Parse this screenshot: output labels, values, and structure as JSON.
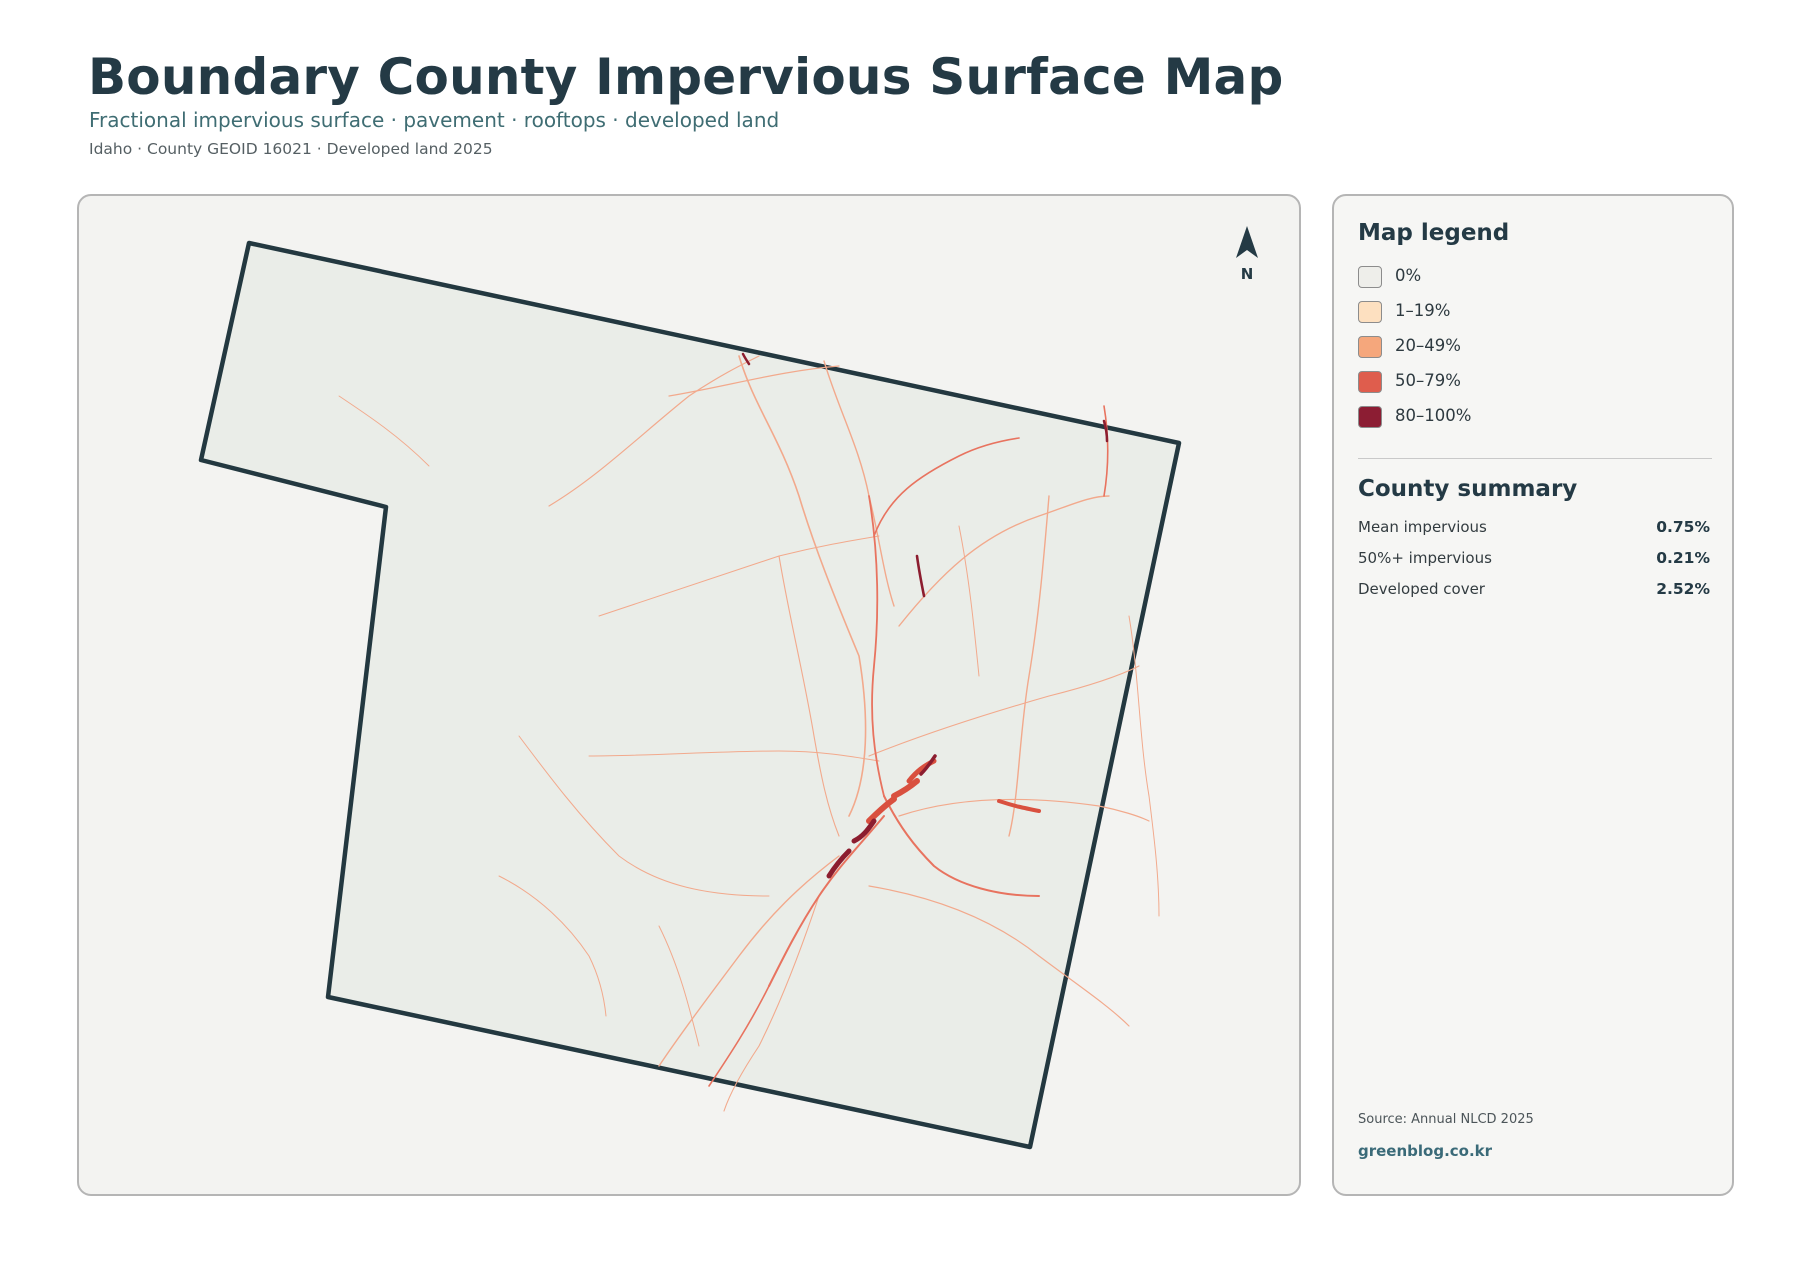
{
  "header": {
    "title": "Boundary County Impervious Surface Map",
    "subtitle": "Fractional impervious surface · pavement · rooftops · developed land",
    "meta": "Idaho · County GEOID 16021 · Developed land 2025"
  },
  "map": {
    "north_label": "N",
    "boundary_color": "#233840",
    "county_fill": "#eaede8",
    "road_colors": [
      "#f2a98c",
      "#e8735f",
      "#d9503f",
      "#8c1d2f"
    ]
  },
  "legend": {
    "title": "Map legend",
    "items": [
      {
        "label": "0%",
        "color": "#eeeeea"
      },
      {
        "label": "1–19%",
        "color": "#fde0c0"
      },
      {
        "label": "20–49%",
        "color": "#f5a77c"
      },
      {
        "label": "50–79%",
        "color": "#df5d4d"
      },
      {
        "label": "80–100%",
        "color": "#8c1d33"
      }
    ]
  },
  "summary": {
    "title": "County summary",
    "stats": [
      {
        "label": "Mean impervious",
        "value": "0.75%"
      },
      {
        "label": "50%+ impervious",
        "value": "0.21%"
      },
      {
        "label": "Developed cover",
        "value": "2.52%"
      }
    ]
  },
  "footer": {
    "source": "Source: Annual NLCD 2025",
    "site": "greenblog.co.kr"
  }
}
